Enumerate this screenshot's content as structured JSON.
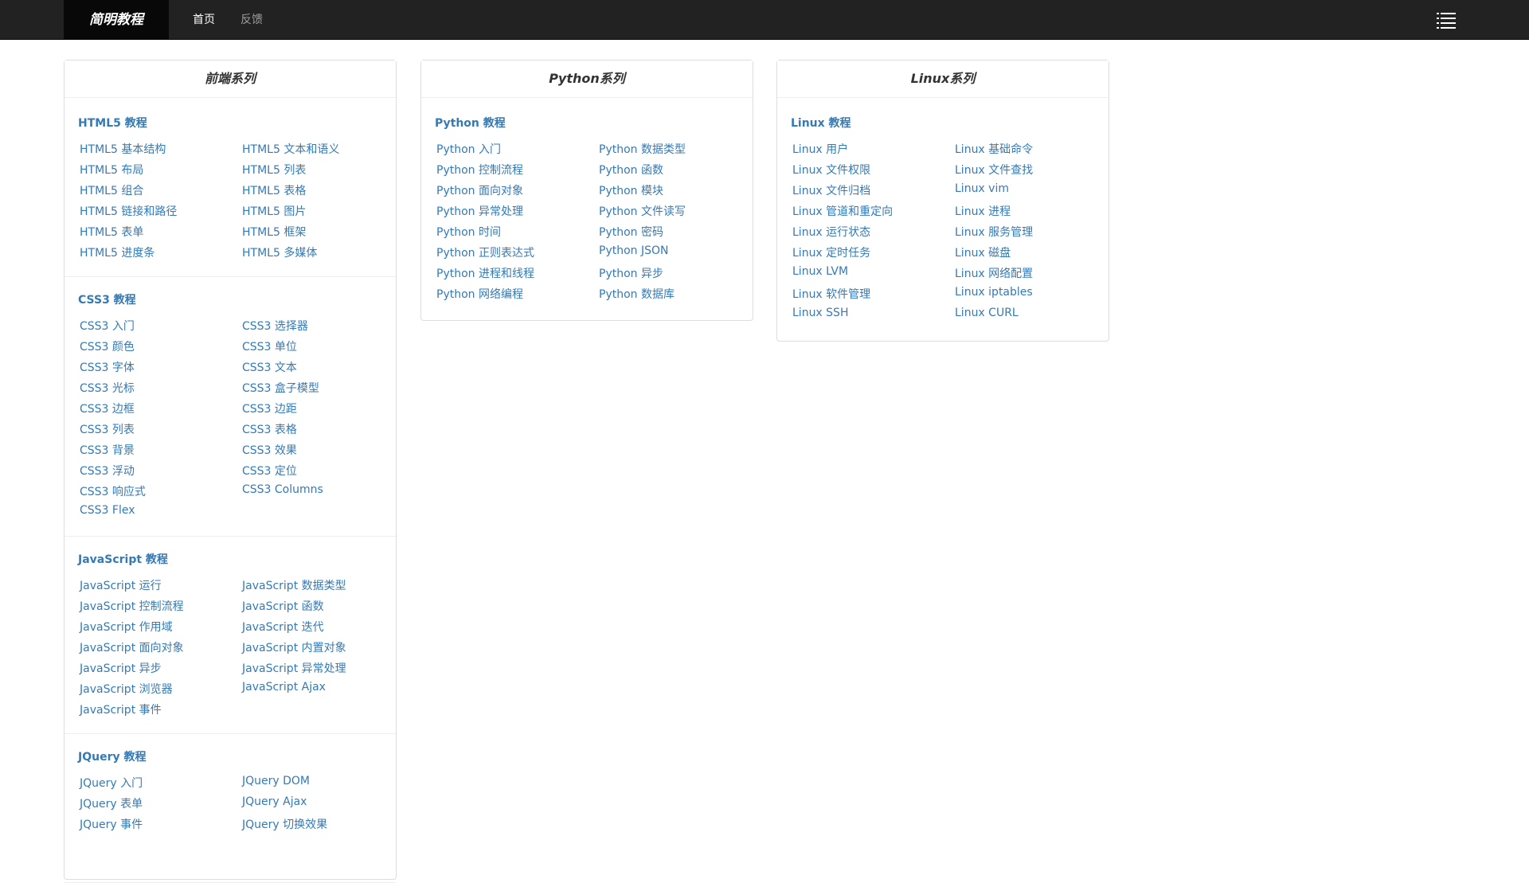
{
  "navbar": {
    "brand": "简明教程",
    "links": [
      "首页",
      "反馈"
    ],
    "menu_icon": "hamburger-menu-icon"
  },
  "panels": [
    {
      "title": "前端系列",
      "sections": [
        {
          "title": "HTML5 教程",
          "links": [
            "HTML5 基本结构",
            "HTML5 文本和语义",
            "HTML5 布局",
            "HTML5 列表",
            "HTML5 组合",
            "HTML5 表格",
            "HTML5 链接和路径",
            "HTML5 图片",
            "HTML5 表单",
            "HTML5 框架",
            "HTML5 进度条",
            "HTML5 多媒体"
          ]
        },
        {
          "title": "CSS3 教程",
          "links": [
            "CSS3 入门",
            "CSS3 选择器",
            "CSS3 颜色",
            "CSS3 单位",
            "CSS3 字体",
            "CSS3 文本",
            "CSS3 光标",
            "CSS3 盒子模型",
            "CSS3 边框",
            "CSS3 边距",
            "CSS3 列表",
            "CSS3 表格",
            "CSS3 背景",
            "CSS3 效果",
            "CSS3 浮动",
            "CSS3 定位",
            "CSS3 响应式",
            "CSS3 Columns",
            "CSS3 Flex"
          ]
        },
        {
          "title": "JavaScript 教程",
          "links": [
            "JavaScript 运行",
            "JavaScript 数据类型",
            "JavaScript 控制流程",
            "JavaScript 函数",
            "JavaScript 作用域",
            "JavaScript 迭代",
            "JavaScript 面向对象",
            "JavaScript 内置对象",
            "JavaScript 异步",
            "JavaScript 异常处理",
            "JavaScript 浏览器",
            "JavaScript Ajax",
            "JavaScript 事件"
          ]
        },
        {
          "title": "JQuery 教程",
          "links": [
            "JQuery 入门",
            "JQuery DOM",
            "JQuery 表单",
            "JQuery Ajax",
            "JQuery 事件",
            "JQuery 切换效果"
          ]
        }
      ]
    },
    {
      "title": "Python系列",
      "sections": [
        {
          "title": "Python 教程",
          "links": [
            "Python 入门",
            "Python 数据类型",
            "Python 控制流程",
            "Python 函数",
            "Python 面向对象",
            "Python 模块",
            "Python 异常处理",
            "Python 文件读写",
            "Python 时间",
            "Python 密码",
            "Python 正则表达式",
            "Python JSON",
            "Python 进程和线程",
            "Python 异步",
            "Python 网络编程",
            "Python 数据库"
          ]
        }
      ]
    },
    {
      "title": "Linux系列",
      "sections": [
        {
          "title": "Linux 教程",
          "links": [
            "Linux 用户",
            "Linux 基础命令",
            "Linux 文件权限",
            "Linux 文件查找",
            "Linux 文件归档",
            "Linux vim",
            "Linux 管道和重定向",
            "Linux 进程",
            "Linux 运行状态",
            "Linux 服务管理",
            "Linux 定时任务",
            "Linux 磁盘",
            "Linux LVM",
            "Linux 网络配置",
            "Linux 软件管理",
            "Linux iptables",
            "Linux SSH",
            "Linux CURL"
          ]
        }
      ]
    }
  ],
  "colors": {
    "navbar_bg": "#222222",
    "brand_bg": "#080808",
    "link": "#337ab7",
    "nav_active": "#ffffff",
    "nav_muted": "#9d9d9d",
    "panel_border": "#dddddd",
    "heading_text": "#333333"
  }
}
